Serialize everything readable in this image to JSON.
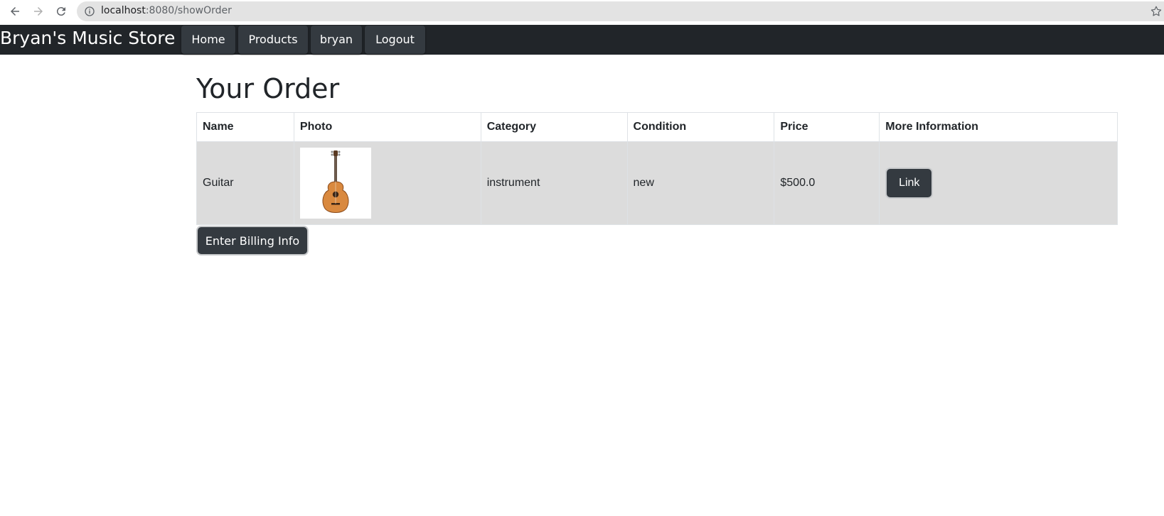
{
  "browser": {
    "url_host": "localhost",
    "url_rest": ":8080/showOrder",
    "icons": {
      "back": "back-arrow-icon",
      "forward": "forward-arrow-icon",
      "reload": "reload-icon",
      "info": "info-icon",
      "star": "bookmark-star-icon"
    }
  },
  "navbar": {
    "brand": "Bryan's Music Store",
    "items": [
      {
        "label": "Home"
      },
      {
        "label": "Products"
      },
      {
        "label": "bryan"
      },
      {
        "label": "Logout"
      }
    ]
  },
  "page": {
    "title": "Your Order"
  },
  "table": {
    "headers": [
      "Name",
      "Photo",
      "Category",
      "Condition",
      "Price",
      "More Information"
    ],
    "rows": [
      {
        "name": "Guitar",
        "photo_icon": "guitar-icon",
        "category": "instrument",
        "condition": "new",
        "price": "$500.0",
        "link_label": "Link"
      }
    ]
  },
  "actions": {
    "billing_label": "Enter Billing Info"
  },
  "colors": {
    "navbar_bg": "#212529",
    "nav_item_bg": "#343a40",
    "row_bg": "#dcdcdc"
  }
}
